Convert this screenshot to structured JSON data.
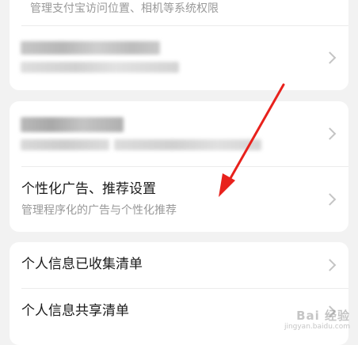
{
  "card_top": {
    "item_system_permissions": {
      "subtitle": "管理支付宝访问位置、相机等系统权限"
    }
  },
  "card_mid": {
    "item_personalized_ads": {
      "title": "个性化广告、推荐设置",
      "subtitle": "管理程序化的广告与个性化推荐"
    }
  },
  "card_bottom": {
    "item_collected_info": {
      "title": "个人信息已收集清单"
    },
    "item_shared_info": {
      "title": "个人信息共享清单"
    }
  },
  "watermark": {
    "brand": "Bai 经验",
    "domain": "jingyan.baidu.com"
  },
  "colors": {
    "annotation_arrow": "#e8211c",
    "background": "#f2f2f2",
    "card": "#ffffff"
  },
  "icons": {
    "chevron": "chevron-right-icon",
    "arrow": "red-arrow-annotation"
  }
}
